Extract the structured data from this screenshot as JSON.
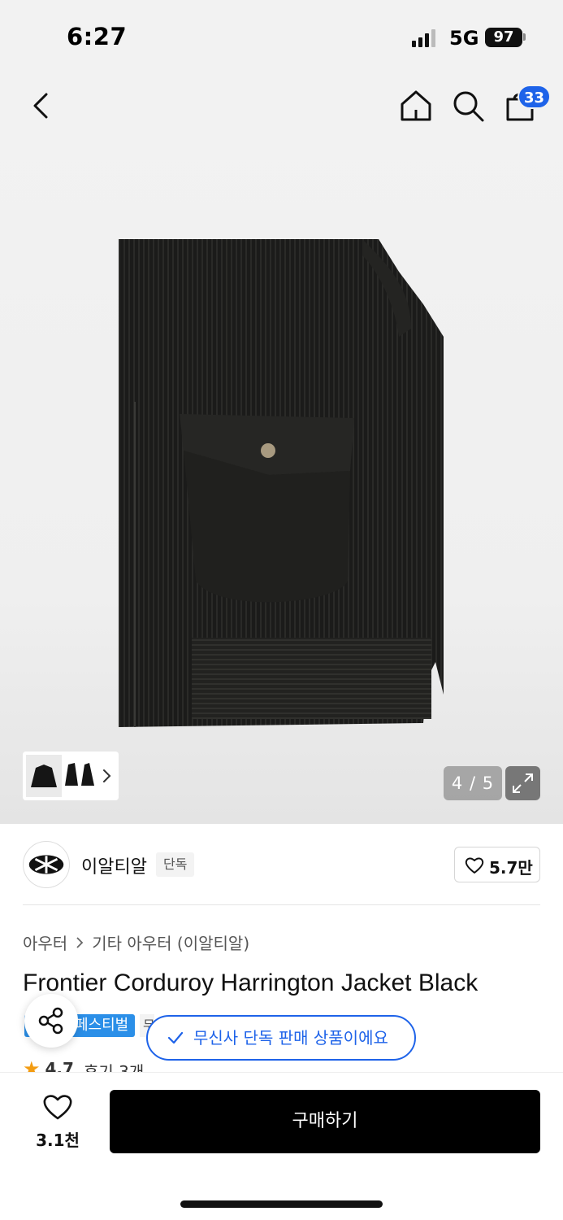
{
  "status_bar": {
    "time": "6:27",
    "network": "5G",
    "battery": "97"
  },
  "header": {
    "cart_count": "33"
  },
  "gallery": {
    "counter": "4 / 5"
  },
  "brand": {
    "name": "이알티알",
    "tag": "단독",
    "like_count": "5.7만"
  },
  "breadcrumb": {
    "items": [
      "아우터",
      "기타 아우터 (이알티알)"
    ]
  },
  "product": {
    "title": "Frontier Corduroy Harrington Jacket Black",
    "badge": "페스티벌",
    "badge_2": "무",
    "rating": "4.7",
    "reviews": "후기 3개"
  },
  "notice": {
    "exclusive": "무신사 단독 판매 상품이에요"
  },
  "bottom_bar": {
    "wish_count": "3.1천",
    "buy_label": "구매하기"
  },
  "colors": {
    "accent": "#1e63e9",
    "badge_blue": "#2b8fe8",
    "rating_star": "#f39c12"
  },
  "icons": [
    "back-icon",
    "home-icon",
    "search-icon",
    "cart-icon",
    "expand-icon",
    "heart-icon",
    "share-icon",
    "check-icon",
    "star-icon",
    "chevron-right-icon"
  ]
}
